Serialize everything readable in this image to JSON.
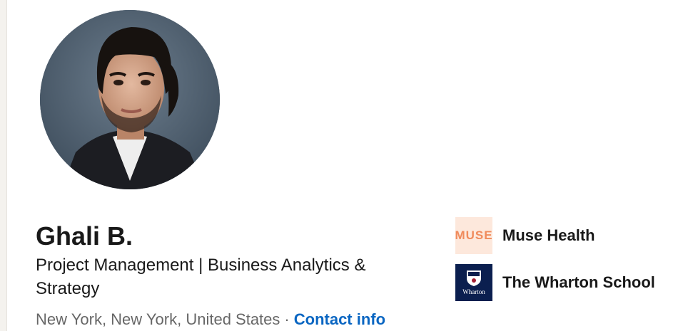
{
  "profile": {
    "name": "Ghali B.",
    "headline": "Project Management | Business Analytics & Strategy",
    "location": "New York, New York, United States",
    "separator": "·",
    "contact_label": "Contact info"
  },
  "organizations": [
    {
      "name": "Muse Health",
      "logo_text": "MUSE",
      "logo_icon": "muse-health-logo"
    },
    {
      "name": "The Wharton School",
      "logo_text": "Wharton",
      "logo_icon": "wharton-shield-logo"
    }
  ],
  "colors": {
    "link": "#0a66c2",
    "muse_logo_bg": "#fde8dc",
    "muse_logo_text": "#f08b5c",
    "wharton_logo_bg": "#0b1f4f"
  }
}
